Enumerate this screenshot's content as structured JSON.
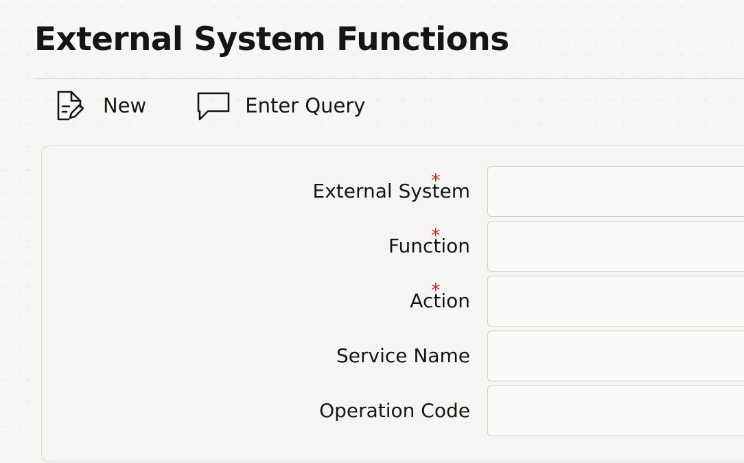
{
  "page": {
    "title": "External System Functions"
  },
  "toolbar": {
    "new_label": "New",
    "enter_query_label": "Enter Query"
  },
  "form": {
    "fields": [
      {
        "label": "External System",
        "required": true,
        "value": ""
      },
      {
        "label": "Function",
        "required": true,
        "value": ""
      },
      {
        "label": "Action",
        "required": true,
        "value": ""
      },
      {
        "label": "Service Name",
        "required": false,
        "value": ""
      },
      {
        "label": "Operation Code",
        "required": false,
        "value": ""
      }
    ],
    "required_symbol": "*"
  },
  "colors": {
    "required": "#b0372a",
    "text": "#161513",
    "panel_border": "#dedbd6",
    "input_border": "#cfccc6"
  },
  "icons": {
    "new": "new-document-icon",
    "enter_query": "speech-bubble-icon"
  }
}
